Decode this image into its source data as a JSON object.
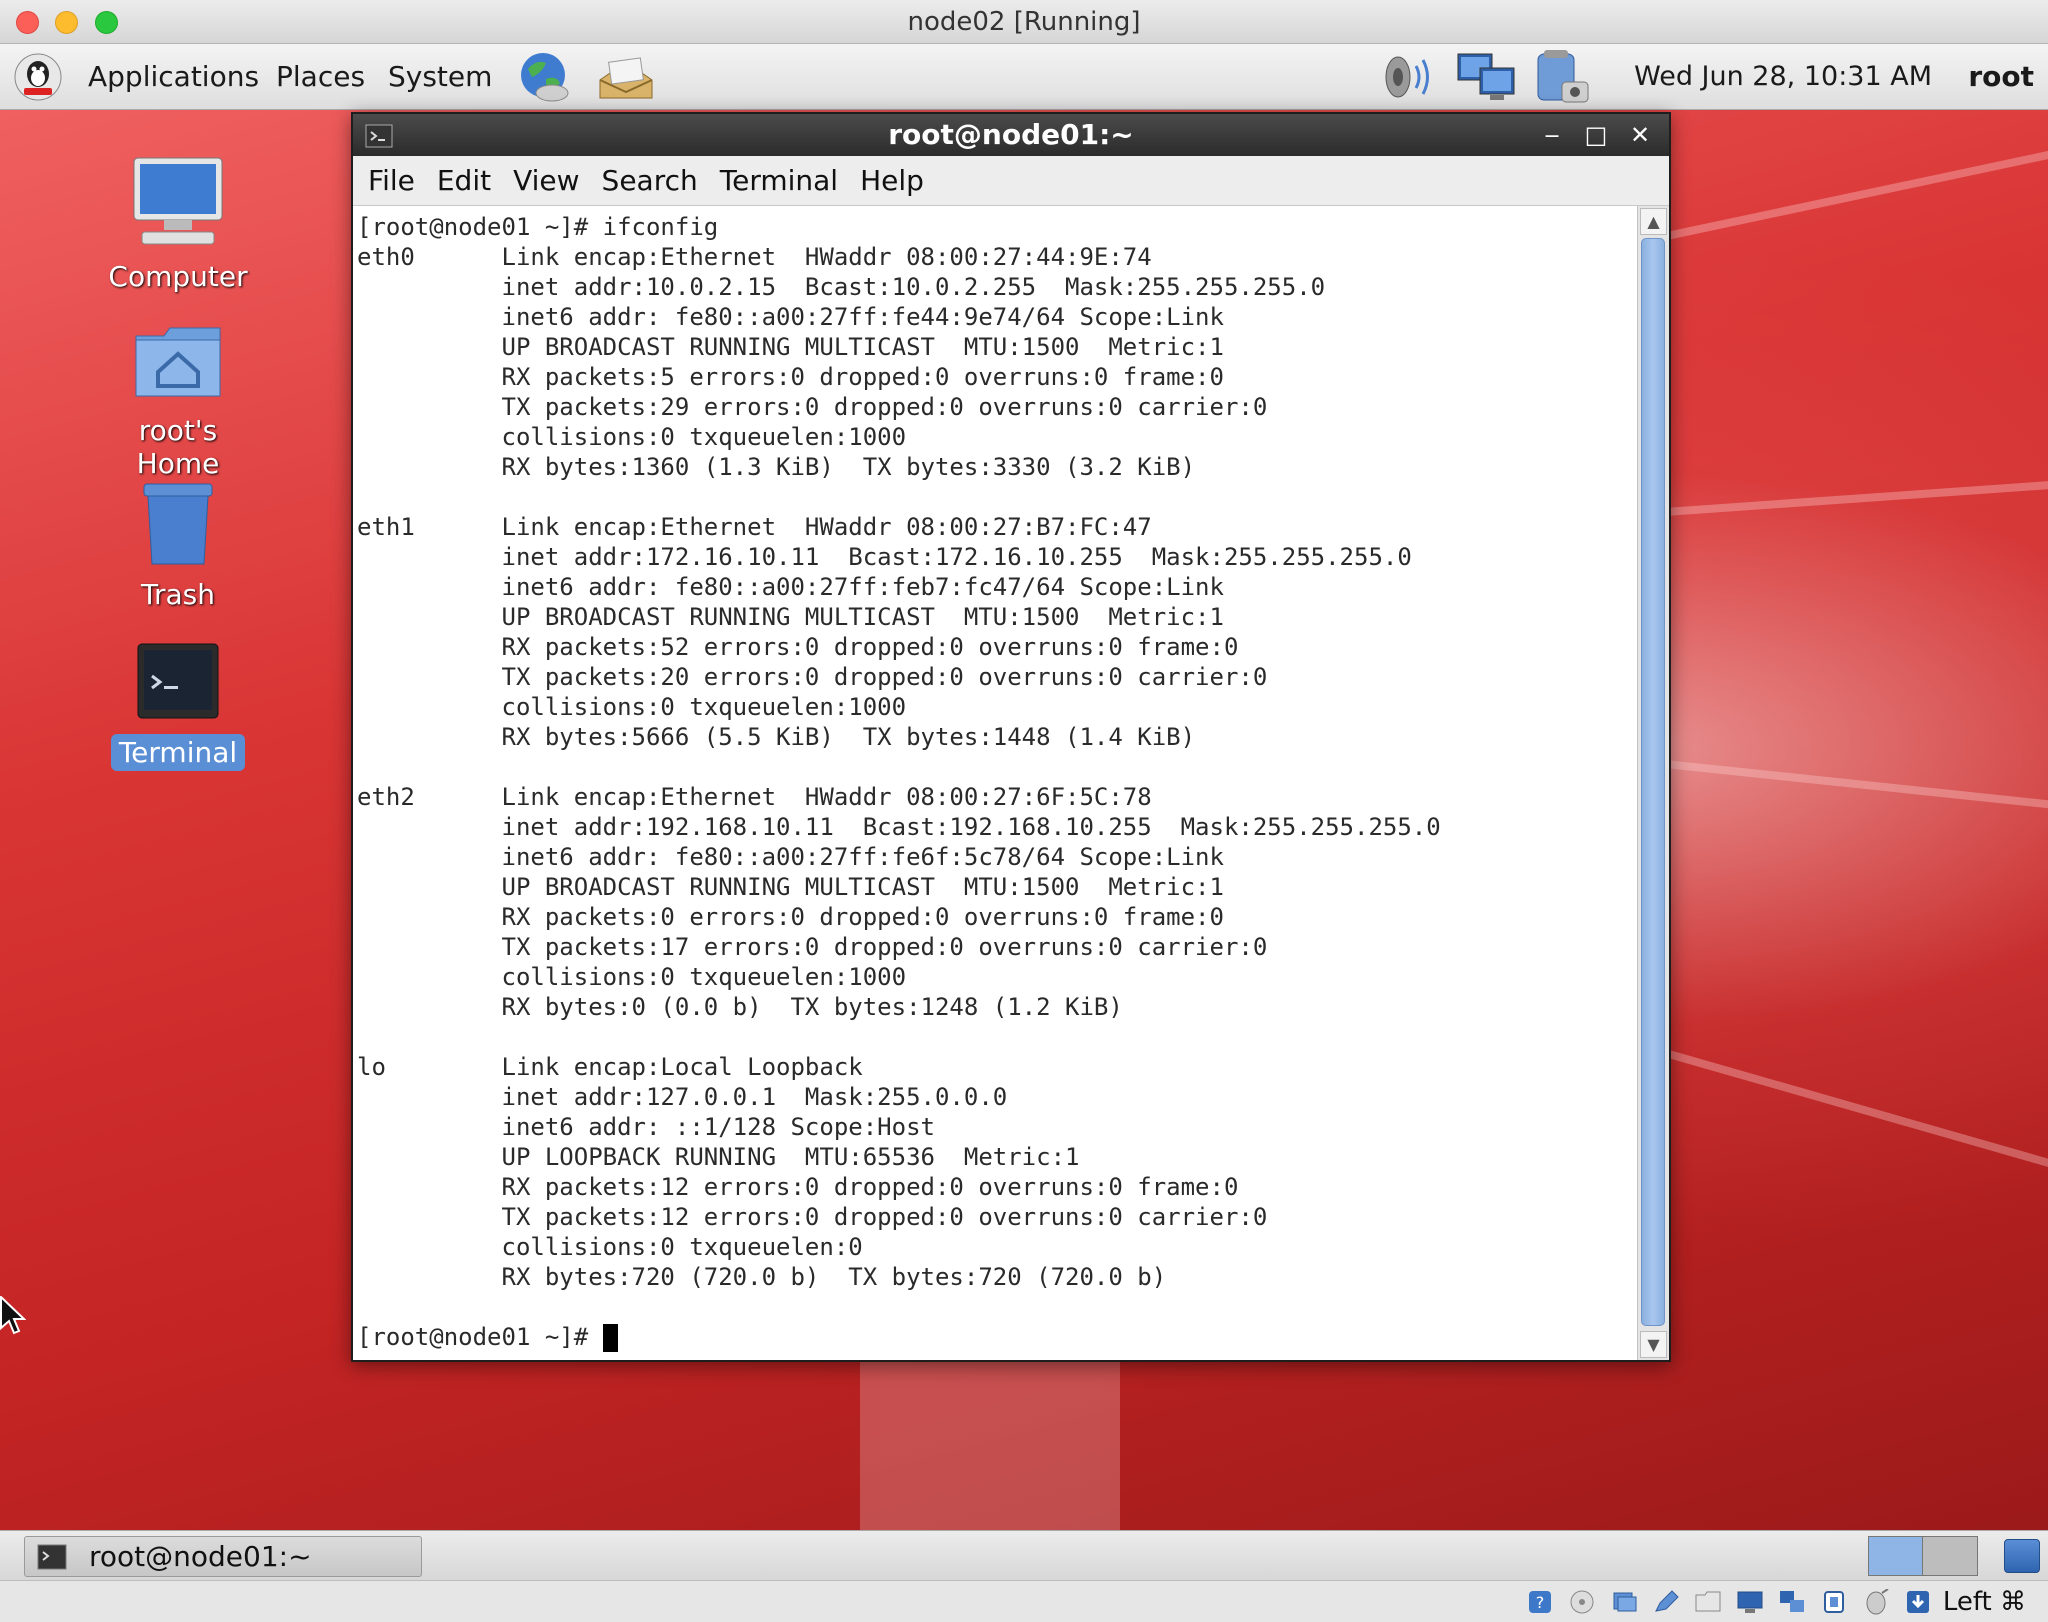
{
  "host_window": {
    "title": "node02 [Running]"
  },
  "top_panel": {
    "menus": [
      "Applications",
      "Places",
      "System"
    ],
    "clock": "Wed Jun 28, 10:31 AM",
    "user": "root",
    "icons": [
      "redhat-menu-icon",
      "browser-globe-icon",
      "email-icon",
      "volume-icon",
      "network-icon",
      "update-icon"
    ]
  },
  "desktop": {
    "icons": [
      {
        "label": "Computer",
        "icon": "computer-icon"
      },
      {
        "label": "root's Home",
        "icon": "home-folder-icon"
      },
      {
        "label": "Trash",
        "icon": "trash-icon"
      },
      {
        "label": "Terminal",
        "icon": "terminal-icon",
        "selected": true
      }
    ]
  },
  "terminal": {
    "title": "root@node01:~",
    "menus": [
      "File",
      "Edit",
      "View",
      "Search",
      "Terminal",
      "Help"
    ],
    "lines": [
      "[root@node01 ~]# ifconfig",
      "eth0      Link encap:Ethernet  HWaddr 08:00:27:44:9E:74",
      "          inet addr:10.0.2.15  Bcast:10.0.2.255  Mask:255.255.255.0",
      "          inet6 addr: fe80::a00:27ff:fe44:9e74/64 Scope:Link",
      "          UP BROADCAST RUNNING MULTICAST  MTU:1500  Metric:1",
      "          RX packets:5 errors:0 dropped:0 overruns:0 frame:0",
      "          TX packets:29 errors:0 dropped:0 overruns:0 carrier:0",
      "          collisions:0 txqueuelen:1000",
      "          RX bytes:1360 (1.3 KiB)  TX bytes:3330 (3.2 KiB)",
      "",
      "eth1      Link encap:Ethernet  HWaddr 08:00:27:B7:FC:47",
      "          inet addr:172.16.10.11  Bcast:172.16.10.255  Mask:255.255.255.0",
      "          inet6 addr: fe80::a00:27ff:feb7:fc47/64 Scope:Link",
      "          UP BROADCAST RUNNING MULTICAST  MTU:1500  Metric:1",
      "          RX packets:52 errors:0 dropped:0 overruns:0 frame:0",
      "          TX packets:20 errors:0 dropped:0 overruns:0 carrier:0",
      "          collisions:0 txqueuelen:1000",
      "          RX bytes:5666 (5.5 KiB)  TX bytes:1448 (1.4 KiB)",
      "",
      "eth2      Link encap:Ethernet  HWaddr 08:00:27:6F:5C:78",
      "          inet addr:192.168.10.11  Bcast:192.168.10.255  Mask:255.255.255.0",
      "          inet6 addr: fe80::a00:27ff:fe6f:5c78/64 Scope:Link",
      "          UP BROADCAST RUNNING MULTICAST  MTU:1500  Metric:1",
      "          RX packets:0 errors:0 dropped:0 overruns:0 frame:0",
      "          TX packets:17 errors:0 dropped:0 overruns:0 carrier:0",
      "          collisions:0 txqueuelen:1000",
      "          RX bytes:0 (0.0 b)  TX bytes:1248 (1.2 KiB)",
      "",
      "lo        Link encap:Local Loopback",
      "          inet addr:127.0.0.1  Mask:255.0.0.0",
      "          inet6 addr: ::1/128 Scope:Host",
      "          UP LOOPBACK RUNNING  MTU:65536  Metric:1",
      "          RX packets:12 errors:0 dropped:0 overruns:0 frame:0",
      "          TX packets:12 errors:0 dropped:0 overruns:0 carrier:0",
      "          collisions:0 txqueuelen:0",
      "          RX bytes:720 (720.0 b)  TX bytes:720 (720.0 b)",
      ""
    ],
    "prompt": "[root@node01 ~]# "
  },
  "taskbar": {
    "task_label": "root@node01:~"
  },
  "vbox_status": {
    "host_key": "Left ⌘",
    "icons": [
      "vb-help-icon",
      "vb-optical-icon",
      "vb-usb-icon",
      "vb-pen-icon",
      "vb-shared-folder-icon",
      "vb-display-icon",
      "vb-network-icon",
      "vb-cpu-icon",
      "vb-mouse-icon",
      "vb-download-icon"
    ]
  },
  "colors": {
    "accent": "#5a8fd6",
    "desktop_red": "#d93535",
    "terminal_title": "#2b2b2b"
  }
}
